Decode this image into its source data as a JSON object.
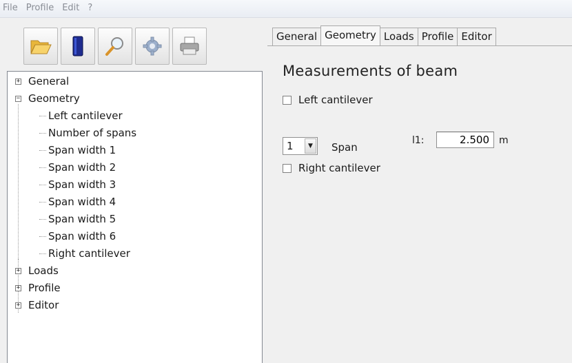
{
  "menu": [
    "File",
    "Profile",
    "Edit",
    "?"
  ],
  "toolbar": {
    "icons": [
      "folder-open-icon",
      "book-icon",
      "magnifier-icon",
      "gear-icon",
      "printer-icon"
    ]
  },
  "tree": {
    "items": [
      {
        "label": "General",
        "toggle": "+",
        "level": 0
      },
      {
        "label": "Geometry",
        "toggle": "−",
        "level": 0
      },
      {
        "label": "Left cantilever",
        "level": 1
      },
      {
        "label": "Number of spans",
        "level": 1
      },
      {
        "label": "Span width 1",
        "level": 1
      },
      {
        "label": "Span width 2",
        "level": 1
      },
      {
        "label": "Span width 3",
        "level": 1
      },
      {
        "label": "Span width 4",
        "level": 1
      },
      {
        "label": "Span width 5",
        "level": 1
      },
      {
        "label": "Span width 6",
        "level": 1
      },
      {
        "label": "Right cantilever",
        "level": 1
      },
      {
        "label": "Loads",
        "toggle": "+",
        "level": 0
      },
      {
        "label": "Profile",
        "toggle": "+",
        "level": 0
      },
      {
        "label": "Editor",
        "toggle": "+",
        "level": 0
      }
    ]
  },
  "tabs": [
    {
      "label": "General",
      "active": false
    },
    {
      "label": "Geometry",
      "active": true
    },
    {
      "label": "Loads",
      "active": false
    },
    {
      "label": "Profile",
      "active": false
    },
    {
      "label": "Editor",
      "active": false
    }
  ],
  "panel": {
    "title": "Measurements of beam",
    "left_cantilever_label": "Left cantilever",
    "left_cantilever_checked": false,
    "span_count": "1",
    "span_label": "Span",
    "l1_label": "l1:",
    "l1_value": "2.500",
    "unit": "m",
    "right_cantilever_label": "Right cantilever",
    "right_cantilever_checked": false
  },
  "colors": {
    "pane_bg": "#f0f0f0",
    "border": "#828790",
    "folder": "#f2c94c",
    "book": "#1f2c8f"
  }
}
